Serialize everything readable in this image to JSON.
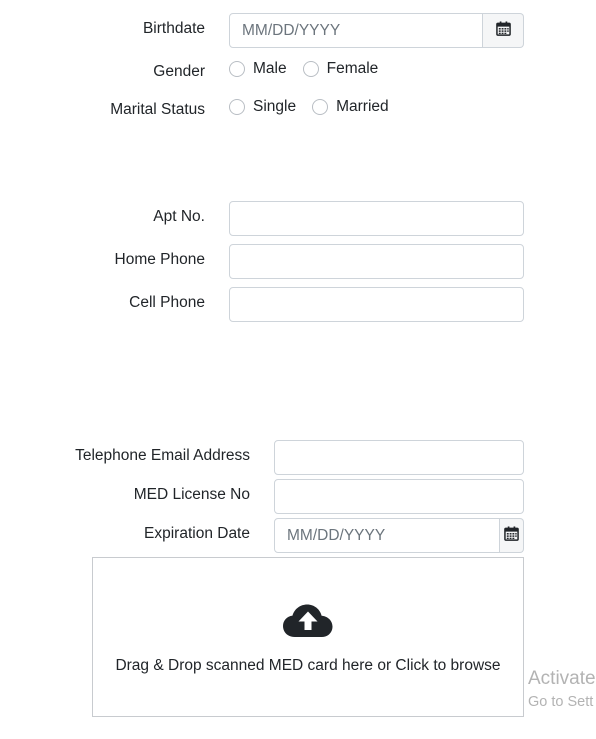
{
  "personal": {
    "birthdate_label": "Birthdate",
    "birthdate_placeholder": "MM/DD/YYYY",
    "birthdate_value": "",
    "gender_label": "Gender",
    "gender_options": [
      "Male",
      "Female"
    ],
    "marital_label": "Marital Status",
    "marital_options": [
      "Single",
      "Married"
    ]
  },
  "address": {
    "apt_label": "Apt No.",
    "apt_value": "",
    "home_phone_label": "Home Phone",
    "home_phone_value": "",
    "cell_phone_label": "Cell Phone",
    "cell_phone_value": ""
  },
  "license": {
    "email_label": "Telephone Email Address",
    "email_value": "",
    "med_license_label": "MED License No",
    "med_license_value": "",
    "expiration_label": "Expiration Date",
    "expiration_placeholder": "MM/DD/YYYY",
    "expiration_value": ""
  },
  "upload": {
    "icon": "cloud-upload-icon",
    "text": "Drag & Drop scanned MED card here or Click to browse"
  },
  "watermark": {
    "line1": "Activate",
    "line2": "Go to Sett"
  },
  "colors": {
    "border": "#ced4da",
    "text": "#212529",
    "placeholder": "#6c757d",
    "icon": "#212529",
    "addon_bg": "#f5f6f7"
  }
}
